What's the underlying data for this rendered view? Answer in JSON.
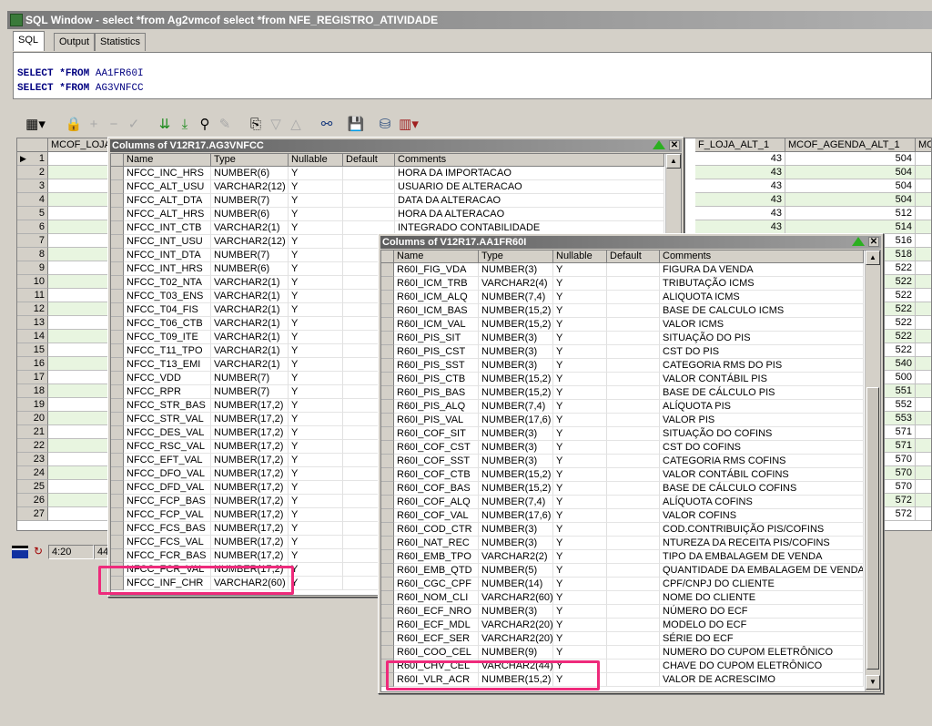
{
  "window": {
    "title": "SQL Window - select *from Ag2vmcof select *from NFE_REGISTRO_ATIVIDADE"
  },
  "tabs": [
    "SQL",
    "Output",
    "Statistics"
  ],
  "editor": {
    "lines": [
      {
        "kw1": "SELECT",
        "kw2": "*FROM",
        "table": "AA1FR60I"
      },
      {
        "kw1": "SELECT",
        "kw2": "*FROM",
        "table": "AG3VNFCC"
      }
    ]
  },
  "toolbar": {
    "icons": [
      "grid-icon",
      "lock-icon",
      "plus-icon",
      "minus-icon",
      "check-icon",
      "double-down-icon",
      "double-down-alt-icon",
      "binoculars-icon",
      "eraser-icon",
      "export-icon",
      "triangle-down-icon",
      "triangle-up-icon",
      "link-icon",
      "save-icon",
      "database-icon",
      "chart-icon"
    ]
  },
  "grid": {
    "left_header": "MCOF_LOJA",
    "right_headers": [
      "F_LOJA_ALT_1",
      "MCOF_AGENDA_ALT_1",
      "MCOF"
    ],
    "rows": [
      {
        "n": "1",
        "a": "43",
        "b": "504"
      },
      {
        "n": "2",
        "a": "43",
        "b": "504"
      },
      {
        "n": "3",
        "a": "43",
        "b": "504"
      },
      {
        "n": "4",
        "a": "43",
        "b": "504"
      },
      {
        "n": "5",
        "a": "43",
        "b": "512"
      },
      {
        "n": "6",
        "a": "43",
        "b": "514"
      },
      {
        "n": "7",
        "a": "",
        "b": "516"
      },
      {
        "n": "8",
        "a": "",
        "b": "518"
      },
      {
        "n": "9",
        "a": "",
        "b": "522"
      },
      {
        "n": "10",
        "a": "",
        "b": "522"
      },
      {
        "n": "11",
        "a": "",
        "b": "522"
      },
      {
        "n": "12",
        "a": "",
        "b": "522"
      },
      {
        "n": "13",
        "a": "",
        "b": "522"
      },
      {
        "n": "14",
        "a": "",
        "b": "522"
      },
      {
        "n": "15",
        "a": "",
        "b": "522"
      },
      {
        "n": "16",
        "a": "",
        "b": "540"
      },
      {
        "n": "17",
        "a": "",
        "b": "500"
      },
      {
        "n": "18",
        "a": "",
        "b": "551"
      },
      {
        "n": "19",
        "a": "",
        "b": "552"
      },
      {
        "n": "20",
        "a": "",
        "b": "553"
      },
      {
        "n": "21",
        "a": "",
        "b": "571"
      },
      {
        "n": "22",
        "a": "",
        "b": "571"
      },
      {
        "n": "23",
        "a": "",
        "b": "570"
      },
      {
        "n": "24",
        "a": "",
        "b": "570"
      },
      {
        "n": "25",
        "a": "",
        "b": "570"
      },
      {
        "n": "26",
        "a": "",
        "b": "572"
      },
      {
        "n": "27",
        "a": "",
        "b": "572"
      }
    ]
  },
  "statusbar": {
    "time": "4:20",
    "extra": "44"
  },
  "popup1": {
    "title": "Columns of V12R17.AG3VNFCC",
    "headers": [
      "Name",
      "Type",
      "Nullable",
      "Default",
      "Comments"
    ],
    "rows": [
      [
        "NFCC_INC_HRS",
        "NUMBER(6)",
        "Y",
        "",
        "HORA DA IMPORTACAO"
      ],
      [
        "NFCC_ALT_USU",
        "VARCHAR2(12)",
        "Y",
        "",
        "USUARIO DE ALTERACAO"
      ],
      [
        "NFCC_ALT_DTA",
        "NUMBER(7)",
        "Y",
        "",
        "DATA DA ALTERACAO"
      ],
      [
        "NFCC_ALT_HRS",
        "NUMBER(6)",
        "Y",
        "",
        "HORA DA ALTERACAO"
      ],
      [
        "NFCC_INT_CTB",
        "VARCHAR2(1)",
        "Y",
        "",
        "INTEGRADO CONTABILIDADE"
      ],
      [
        "NFCC_INT_USU",
        "VARCHAR2(12)",
        "Y",
        "",
        ""
      ],
      [
        "NFCC_INT_DTA",
        "NUMBER(7)",
        "Y",
        "",
        ""
      ],
      [
        "NFCC_INT_HRS",
        "NUMBER(6)",
        "Y",
        "",
        ""
      ],
      [
        "NFCC_T02_NTA",
        "VARCHAR2(1)",
        "Y",
        "",
        ""
      ],
      [
        "NFCC_T03_ENS",
        "VARCHAR2(1)",
        "Y",
        "",
        ""
      ],
      [
        "NFCC_T04_FIS",
        "VARCHAR2(1)",
        "Y",
        "",
        ""
      ],
      [
        "NFCC_T06_CTB",
        "VARCHAR2(1)",
        "Y",
        "",
        ""
      ],
      [
        "NFCC_T09_ITE",
        "VARCHAR2(1)",
        "Y",
        "",
        ""
      ],
      [
        "NFCC_T11_TPO",
        "VARCHAR2(1)",
        "Y",
        "",
        ""
      ],
      [
        "NFCC_T13_EMI",
        "VARCHAR2(1)",
        "Y",
        "",
        ""
      ],
      [
        "NFCC_VDD",
        "NUMBER(7)",
        "Y",
        "",
        ""
      ],
      [
        "NFCC_RPR",
        "NUMBER(7)",
        "Y",
        "",
        ""
      ],
      [
        "NFCC_STR_BAS",
        "NUMBER(17,2)",
        "Y",
        "",
        ""
      ],
      [
        "NFCC_STR_VAL",
        "NUMBER(17,2)",
        "Y",
        "",
        ""
      ],
      [
        "NFCC_DES_VAL",
        "NUMBER(17,2)",
        "Y",
        "",
        ""
      ],
      [
        "NFCC_RSC_VAL",
        "NUMBER(17,2)",
        "Y",
        "",
        ""
      ],
      [
        "NFCC_EFT_VAL",
        "NUMBER(17,2)",
        "Y",
        "",
        ""
      ],
      [
        "NFCC_DFO_VAL",
        "NUMBER(17,2)",
        "Y",
        "",
        ""
      ],
      [
        "NFCC_DFD_VAL",
        "NUMBER(17,2)",
        "Y",
        "",
        ""
      ],
      [
        "NFCC_FCP_BAS",
        "NUMBER(17,2)",
        "Y",
        "",
        ""
      ],
      [
        "NFCC_FCP_VAL",
        "NUMBER(17,2)",
        "Y",
        "",
        ""
      ],
      [
        "NFCC_FCS_BAS",
        "NUMBER(17,2)",
        "Y",
        "",
        ""
      ],
      [
        "NFCC_FCS_VAL",
        "NUMBER(17,2)",
        "Y",
        "",
        ""
      ],
      [
        "NFCC_FCR_BAS",
        "NUMBER(17,2)",
        "Y",
        "",
        ""
      ],
      [
        "NFCC_FCR_VAL",
        "NUMBER(17,2)",
        "Y",
        "",
        ""
      ],
      [
        "NFCC_INF_CHR",
        "VARCHAR2(60)",
        "Y",
        "",
        ""
      ]
    ]
  },
  "popup2": {
    "title": "Columns of V12R17.AA1FR60I",
    "headers": [
      "Name",
      "Type",
      "Nullable",
      "Default",
      "Comments"
    ],
    "rows": [
      [
        "R60I_FIG_VDA",
        "NUMBER(3)",
        "Y",
        "",
        "FIGURA DA VENDA"
      ],
      [
        "R60I_ICM_TRB",
        "VARCHAR2(4)",
        "Y",
        "",
        "TRIBUTAÇÃO ICMS"
      ],
      [
        "R60I_ICM_ALQ",
        "NUMBER(7,4)",
        "Y",
        "",
        "ALIQUOTA ICMS"
      ],
      [
        "R60I_ICM_BAS",
        "NUMBER(15,2)",
        "Y",
        "",
        "BASE DE CALCULO ICMS"
      ],
      [
        "R60I_ICM_VAL",
        "NUMBER(15,2)",
        "Y",
        "",
        "VALOR ICMS"
      ],
      [
        "R60I_PIS_SIT",
        "NUMBER(3)",
        "Y",
        "",
        "SITUAÇÃO DO PIS"
      ],
      [
        "R60I_PIS_CST",
        "NUMBER(3)",
        "Y",
        "",
        "CST DO PIS"
      ],
      [
        "R60I_PIS_SST",
        "NUMBER(3)",
        "Y",
        "",
        "CATEGORIA RMS DO PIS"
      ],
      [
        "R60I_PIS_CTB",
        "NUMBER(15,2)",
        "Y",
        "",
        "VALOR CONTÁBIL PIS"
      ],
      [
        "R60I_PIS_BAS",
        "NUMBER(15,2)",
        "Y",
        "",
        "BASE DE CÁLCULO PIS"
      ],
      [
        "R60I_PIS_ALQ",
        "NUMBER(7,4)",
        "Y",
        "",
        "ALÍQUOTA PIS"
      ],
      [
        "R60I_PIS_VAL",
        "NUMBER(17,6)",
        "Y",
        "",
        "VALOR PIS"
      ],
      [
        "R60I_COF_SIT",
        "NUMBER(3)",
        "Y",
        "",
        "SITUAÇÃO DO COFINS"
      ],
      [
        "R60I_COF_CST",
        "NUMBER(3)",
        "Y",
        "",
        "CST DO COFINS"
      ],
      [
        "R60I_COF_SST",
        "NUMBER(3)",
        "Y",
        "",
        "CATEGORIA RMS COFINS"
      ],
      [
        "R60I_COF_CTB",
        "NUMBER(15,2)",
        "Y",
        "",
        "VALOR CONTÁBIL COFINS"
      ],
      [
        "R60I_COF_BAS",
        "NUMBER(15,2)",
        "Y",
        "",
        "BASE DE CÁLCULO COFINS"
      ],
      [
        "R60I_COF_ALQ",
        "NUMBER(7,4)",
        "Y",
        "",
        "ALÍQUOTA COFINS"
      ],
      [
        "R60I_COF_VAL",
        "NUMBER(17,6)",
        "Y",
        "",
        "VALOR COFINS"
      ],
      [
        "R60I_COD_CTR",
        "NUMBER(3)",
        "Y",
        "",
        "COD.CONTRIBUIÇÃO PIS/COFINS"
      ],
      [
        "R60I_NAT_REC",
        "NUMBER(3)",
        "Y",
        "",
        "NTUREZA DA RECEITA PIS/COFINS"
      ],
      [
        "R60I_EMB_TPO",
        "VARCHAR2(2)",
        "Y",
        "",
        "TIPO DA EMBALAGEM DE VENDA"
      ],
      [
        "R60I_EMB_QTD",
        "NUMBER(5)",
        "Y",
        "",
        "QUANTIDADE DA EMBALAGEM DE VENDA"
      ],
      [
        "R60I_CGC_CPF",
        "NUMBER(14)",
        "Y",
        "",
        "CPF/CNPJ DO CLIENTE"
      ],
      [
        "R60I_NOM_CLI",
        "VARCHAR2(60)",
        "Y",
        "",
        "NOME DO CLIENTE"
      ],
      [
        "R60I_ECF_NRO",
        "NUMBER(3)",
        "Y",
        "",
        "NÚMERO DO ECF"
      ],
      [
        "R60I_ECF_MDL",
        "VARCHAR2(20)",
        "Y",
        "",
        "MODELO DO ECF"
      ],
      [
        "R60I_ECF_SER",
        "VARCHAR2(20)",
        "Y",
        "",
        "SÉRIE DO ECF"
      ],
      [
        "R60I_COO_CEL",
        "NUMBER(9)",
        "Y",
        "",
        "NUMERO DO CUPOM ELETRÔNICO"
      ],
      [
        "R60I_CHV_CEL",
        "VARCHAR2(44)",
        "Y",
        "",
        "CHAVE DO CUPOM ELETRÔNICO"
      ],
      [
        "R60I_VLR_ACR",
        "NUMBER(15,2)",
        "Y",
        "",
        "VALOR DE ACRESCIMO"
      ]
    ]
  }
}
